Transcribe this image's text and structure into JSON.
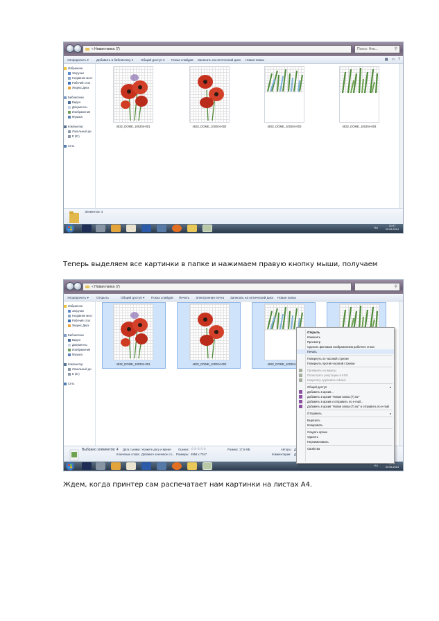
{
  "body_text": {
    "paragraph_1": "Теперь выделяем все картинки в папке и нажимаем правую кнопку мыши, получаем",
    "paragraph_2": "Ждем, когда принтер сам распечатает нам картинки на листах А4."
  },
  "screenshot_1": {
    "address": "« Новая папка (7)",
    "search_placeholder": "Поиск: Нов...",
    "toolbar": [
      "Упорядочить ▾",
      "Добавить в библиотеку ▾",
      "Общий доступ ▾",
      "Показ слайдов",
      "Записать на оптический диск",
      "Новая папка"
    ],
    "nav": {
      "favorites": "Избранное",
      "downloads": "Загрузки",
      "recent": "Недавние мест",
      "desktop": "Рабочий стол",
      "yandex": "Яндекс.Диск",
      "libraries": "Библиотеки",
      "video": "Видео",
      "documents": "Документы",
      "images": "Изображения",
      "music": "Музыка",
      "computer": "Компьютер",
      "local_disk": "Локальный ди",
      "drive_e": "E (E:)",
      "network": "Сеть"
    },
    "files": [
      "4832_DOME_100204-001",
      "4832_DOME_100204-002",
      "4832_DOME_100204-003",
      "4832_DOME_100204-004"
    ],
    "status": "Элементов: 4",
    "clock": {
      "time": "21:07",
      "date": "20.06.2014"
    },
    "lang": "RU"
  },
  "screenshot_2": {
    "address": "« Новая папка (7)",
    "search_placeholder": "",
    "toolbar": [
      "Упорядочить ▾",
      "Открыть",
      "Общий доступ ▾",
      "Показ слайдов",
      "Печать",
      "Электронная почта",
      "Записать на оптический диск",
      "Новая папка"
    ],
    "nav": {
      "favorites": "Избранное",
      "downloads": "Загрузки",
      "recent": "Недавние мест",
      "desktop": "Рабочий стол",
      "yandex": "Яндекс.Диск",
      "libraries": "Библиотеки",
      "video": "Видео",
      "documents": "Документы",
      "images": "Изображения",
      "music": "Музыка",
      "computer": "Компьютер",
      "local_disk": "Локальный ди",
      "drive_e": "E (E:)",
      "network": "Сеть"
    },
    "files": [
      "4832_DOME_100204-001",
      "4832_DOME_100204-002",
      "4832_DOME_100204-003"
    ],
    "details": {
      "selected": "Выбрано элементов: 4",
      "date_label": "Дата съемки:",
      "date_value": "Укажите дату и время",
      "rating_label": "Оценка:",
      "rating_stars": "☆☆☆☆☆",
      "size_label": "Размер:",
      "size_value": "17,5 МБ",
      "authors_label": "Авторы:",
      "authors_value": "Де",
      "keywords_label": "Ключевые слова:",
      "keywords_value": "Добавьте ключевое сл...",
      "dims_label": "Размеры:",
      "dims_value": "4956 x 7017",
      "comments_label": "Комментарии:",
      "comments_value": "Де"
    },
    "clock": {
      "time": "21:08",
      "date": "20.06.2014"
    },
    "lang": "RU",
    "context_menu": [
      {
        "label": "Открыть",
        "bold": true
      },
      {
        "label": "Изменить"
      },
      {
        "label": "Просмотр"
      },
      {
        "label": "Сделать фоновым изображением рабочего стола"
      },
      {
        "label": "Печать",
        "highlight": true
      },
      {
        "sep": true
      },
      {
        "label": "Повернуть по часовой стрелке"
      },
      {
        "label": "Повернуть против часовой стрелки"
      },
      {
        "sep": true
      },
      {
        "label": "Проверить на вирусы",
        "disabled": true,
        "icon": true
      },
      {
        "label": "Посмотреть репутацию в KSN",
        "disabled": true,
        "icon": true
      },
      {
        "label": "Kaspersky Application Advisor",
        "disabled": true,
        "icon": true
      },
      {
        "sep": true
      },
      {
        "label": "Общий доступ",
        "arrow": true
      },
      {
        "label": "Добавить в архив...",
        "icon": true
      },
      {
        "label": "Добавить в архив \"Новая папка (7).rar\"",
        "icon": true
      },
      {
        "label": "Добавить в архив и отправить по e-mail...",
        "icon": true
      },
      {
        "label": "Добавить в архив \"Новая папка (7).rar\" и отправить по e-mail",
        "icon": true
      },
      {
        "sep": true
      },
      {
        "label": "Отправить",
        "arrow": true
      },
      {
        "sep": true
      },
      {
        "label": "Вырезать"
      },
      {
        "label": "Копировать"
      },
      {
        "sep": true
      },
      {
        "label": "Создать ярлык"
      },
      {
        "label": "Удалить"
      },
      {
        "label": "Переименовать"
      },
      {
        "sep": true
      },
      {
        "label": "Свойства"
      }
    ]
  },
  "colors": {
    "selection": "#cfe3fb",
    "poppy_red": "#c7321f",
    "leaf_green": "#4f8a3a",
    "taskbar": "#2b3a4c"
  }
}
